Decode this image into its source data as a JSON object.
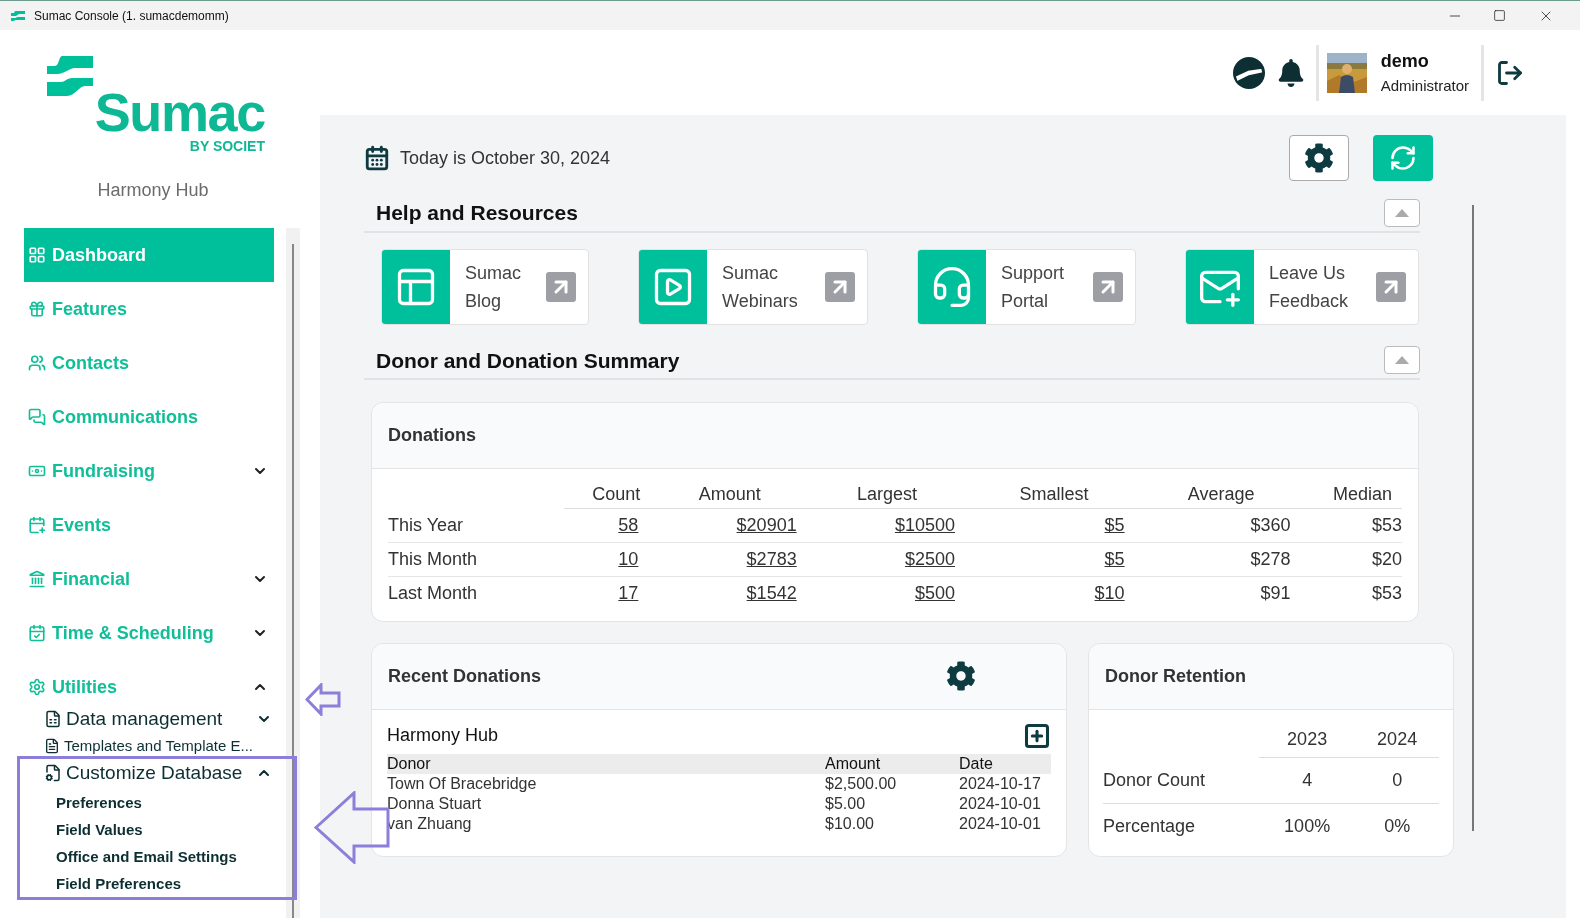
{
  "window": {
    "title": "Sumac Console (1. sumacdemomm)"
  },
  "sidebar": {
    "logo": {
      "name": "Sumac",
      "tagline": "BY SOCIET"
    },
    "organization": "Harmony Hub",
    "items": [
      {
        "label": "Dashboard",
        "selected": true
      },
      {
        "label": "Features",
        "selected": false
      },
      {
        "label": "Contacts",
        "selected": false
      },
      {
        "label": "Communications",
        "selected": false
      },
      {
        "label": "Fundraising",
        "selected": false,
        "expanded": false
      },
      {
        "label": "Events",
        "selected": false
      },
      {
        "label": "Financial",
        "selected": false,
        "expanded": false
      },
      {
        "label": "Time & Scheduling",
        "selected": false,
        "expanded": false
      },
      {
        "label": "Utilities",
        "selected": false,
        "expanded": true,
        "children": [
          {
            "label": "Data management",
            "kind": "group",
            "expanded": false
          },
          {
            "label": "Templates and Template E...",
            "kind": "link"
          },
          {
            "label": "Customize Database",
            "kind": "group",
            "expanded": true,
            "children": [
              {
                "label": "Preferences"
              },
              {
                "label": "Field Values"
              },
              {
                "label": "Office and Email Settings"
              },
              {
                "label": "Field Preferences"
              }
            ]
          }
        ]
      }
    ]
  },
  "user": {
    "name": "demo",
    "role": "Administrator"
  },
  "date": "Today is October 30, 2024",
  "help": {
    "title": "Help and Resources",
    "expanded": true,
    "cards": [
      {
        "lines": [
          "Sumac",
          "Blog"
        ]
      },
      {
        "lines": [
          "Sumac",
          "Webinars"
        ]
      },
      {
        "lines": [
          "Support",
          "Portal"
        ]
      },
      {
        "lines": [
          "Leave Us",
          "Feedback"
        ]
      }
    ]
  },
  "summary": {
    "title": "Donor and Donation Summary",
    "expanded": true,
    "donations": {
      "title": "Donations",
      "columns": [
        "Count",
        "Amount",
        "Largest",
        "Smallest",
        "Average",
        "Median"
      ],
      "rows": [
        {
          "label": "This Year",
          "cells": [
            {
              "text": "58",
              "link": true
            },
            {
              "text": "$20901",
              "link": true
            },
            {
              "text": "$10500",
              "link": true
            },
            {
              "text": "$5",
              "link": true
            },
            {
              "text": "$360",
              "link": false
            },
            {
              "text": "$53",
              "link": false
            }
          ]
        },
        {
          "label": "This Month",
          "cells": [
            {
              "text": "10",
              "link": true
            },
            {
              "text": "$2783",
              "link": true
            },
            {
              "text": "$2500",
              "link": true
            },
            {
              "text": "$5",
              "link": true
            },
            {
              "text": "$278",
              "link": false
            },
            {
              "text": "$20",
              "link": false
            }
          ]
        },
        {
          "label": "Last Month",
          "cells": [
            {
              "text": "17",
              "link": true
            },
            {
              "text": "$1542",
              "link": true
            },
            {
              "text": "$500",
              "link": true
            },
            {
              "text": "$10",
              "link": true
            },
            {
              "text": "$91",
              "link": false
            },
            {
              "text": "$53",
              "link": false
            }
          ]
        }
      ]
    },
    "recent": {
      "title": "Recent Donations",
      "subtitle": "Harmony Hub",
      "columns": [
        "Donor",
        "Amount",
        "Date"
      ],
      "rows": [
        [
          "Town Of Bracebridge",
          "$2,500.00",
          "2024-10-17"
        ],
        [
          "Donna Stuart",
          "$5.00",
          "2024-10-01"
        ],
        [
          "van Zhuang",
          "$10.00",
          "2024-10-01"
        ]
      ]
    },
    "retention": {
      "title": "Donor Retention",
      "columns": [
        "2023",
        "2024"
      ],
      "rows": [
        {
          "label": "Donor Count",
          "values": [
            "4",
            "0"
          ]
        },
        {
          "label": "Percentage",
          "values": [
            "100%",
            "0%"
          ]
        }
      ]
    }
  }
}
